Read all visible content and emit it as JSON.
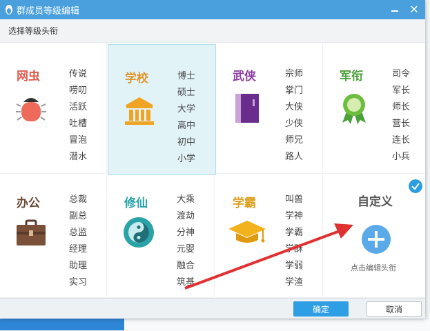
{
  "window": {
    "title": "群成员等级编辑"
  },
  "subheader": {
    "label": "选择等级头衔"
  },
  "cards": [
    {
      "name": "网虫",
      "color": "#e05b4b",
      "icon": "bug-icon",
      "levels": [
        "传说",
        "唠叨",
        "活跃",
        "吐槽",
        "冒泡",
        "潜水"
      ]
    },
    {
      "name": "学校",
      "color": "#e0962a",
      "icon": "school-building-icon",
      "levels": [
        "博士",
        "硕士",
        "大学",
        "高中",
        "初中",
        "小学"
      ]
    },
    {
      "name": "武侠",
      "color": "#8a3fa0",
      "icon": "book-icon",
      "levels": [
        "宗师",
        "掌门",
        "大侠",
        "少侠",
        "师兄",
        "路人"
      ]
    },
    {
      "name": "军衔",
      "color": "#4aa03a",
      "icon": "medal-icon",
      "levels": [
        "司令",
        "军长",
        "师长",
        "营长",
        "连长",
        "小兵"
      ]
    },
    {
      "name": "办公",
      "color": "#6b4a38",
      "icon": "briefcase-icon",
      "levels": [
        "总裁",
        "副总",
        "总监",
        "经理",
        "助理",
        "实习"
      ]
    },
    {
      "name": "修仙",
      "color": "#2aa3a8",
      "icon": "yin-yang-icon",
      "levels": [
        "大乘",
        "渡劫",
        "分神",
        "元婴",
        "融合",
        "筑基"
      ]
    },
    {
      "name": "学霸",
      "color": "#e0a020",
      "icon": "graduation-cap-icon",
      "levels": [
        "叫兽",
        "学神",
        "学霸",
        "学酥",
        "学弱",
        "学渣"
      ]
    }
  ],
  "custom": {
    "title": "自定义",
    "hint": "点击编辑头衔",
    "icon": "plus-icon"
  },
  "footer": {
    "ok_label": "确定",
    "cancel_label": "取消"
  },
  "colors": {
    "accent": "#4aa0dd",
    "selected_bg": "#e2f3f8",
    "arrow": "#e03030"
  }
}
